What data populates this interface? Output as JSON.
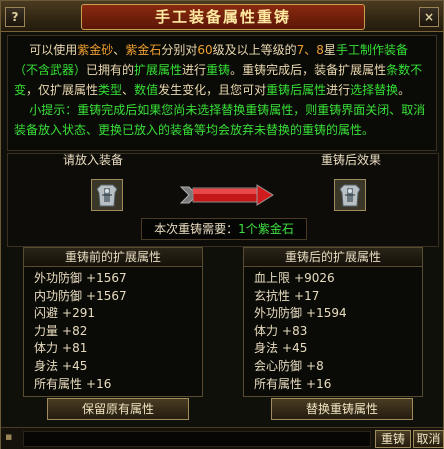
{
  "window": {
    "title": "手工装备属性重铸",
    "help_glyph": "?",
    "close_glyph": "×"
  },
  "description": {
    "p1_a": "可以使用",
    "item1": "紫金砂",
    "p1_b": "、",
    "item2": "紫金石",
    "p1_c": "分别对",
    "level": "60",
    "p1_d": "级及以上等级的",
    "stars": "7、8",
    "p1_e": "星",
    "handmade": "手工制作装备",
    "no_weapon": "（不含武器）",
    "p1_f": "已拥有的",
    "ext_attr": "扩展属性",
    "p1_g": "进行",
    "recast": "重铸",
    "p1_h": "。重铸完成后，装备扩展属性",
    "count_word": "条数不变",
    "p1_i": "，仅扩展属性",
    "type_word": "类型",
    "p1_j": "、",
    "value_word": "数值",
    "p1_k": "发生变化，且您可对",
    "recast_attr": "重铸后属性",
    "p1_l": "进行",
    "select_replace": "选择替换",
    "p1_m": "。",
    "tip": "小提示：重铸完成后如果您尚未选择替换重铸属性，则重铸界面关闭、取消装备放入状态、更换已放入的装备等均会放弃未替换的重铸的属性。"
  },
  "slots": {
    "before_label": "请放入装备",
    "after_label": "重铸后效果",
    "before_icon": "armor-icon",
    "after_icon": "armor-icon"
  },
  "cost": {
    "prefix": "本次重铸需要：",
    "count": "1个",
    "item": "紫金石"
  },
  "before_panel": {
    "title": "重铸前的扩展属性",
    "rows": [
      {
        "name": "外功防御",
        "value": "+1567"
      },
      {
        "name": "内功防御",
        "value": "+1567"
      },
      {
        "name": "闪避",
        "value": "+291"
      },
      {
        "name": "力量",
        "value": "+82"
      },
      {
        "name": "体力",
        "value": "+81"
      },
      {
        "name": "身法",
        "value": "+45"
      },
      {
        "name": "所有属性",
        "value": "+16"
      }
    ]
  },
  "after_panel": {
    "title": "重铸后的扩展属性",
    "rows": [
      {
        "name": "血上限",
        "value": "+9026"
      },
      {
        "name": "玄抗性",
        "value": "+17"
      },
      {
        "name": "外功防御",
        "value": "+1594"
      },
      {
        "name": "体力",
        "value": "+83"
      },
      {
        "name": "身法",
        "value": "+45"
      },
      {
        "name": "会心防御",
        "value": "+8"
      },
      {
        "name": "所有属性",
        "value": "+16"
      }
    ]
  },
  "buttons": {
    "keep": "保留原有属性",
    "replace": "替换重铸属性",
    "recast": "重铸",
    "cancel": "取消"
  },
  "colors": {
    "highlight_green": "#35e035",
    "highlight_orange": "#f0a030",
    "title_bg": "#8a2a10"
  }
}
